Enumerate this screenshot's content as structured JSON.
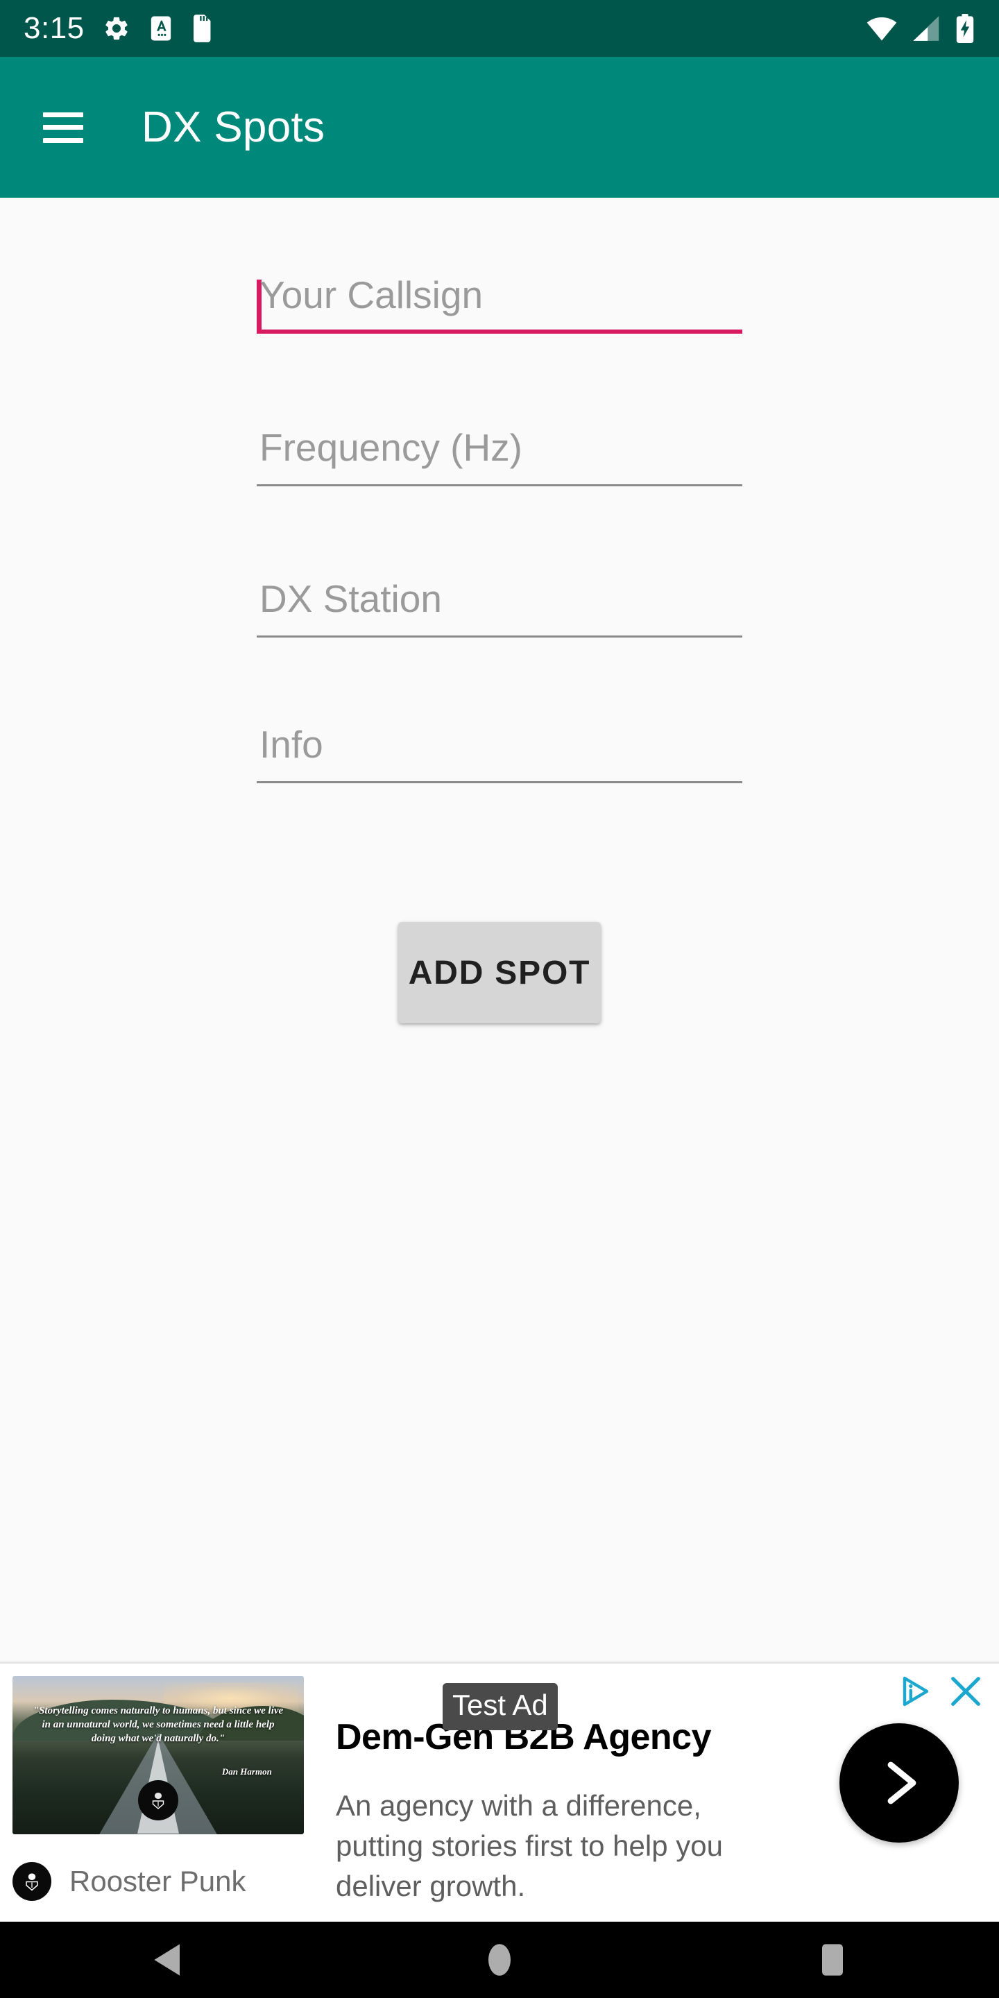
{
  "status_bar": {
    "clock": "3:15",
    "left_icons": [
      {
        "name": "settings-gear-icon"
      },
      {
        "name": "auto-rotate-a-icon"
      },
      {
        "name": "sd-card-icon"
      }
    ],
    "right_icons": [
      {
        "name": "wifi-icon"
      },
      {
        "name": "cellular-signal-icon"
      },
      {
        "name": "battery-charging-icon"
      }
    ],
    "background_color": "#00564B"
  },
  "app_bar": {
    "menu_icon": "hamburger-menu-icon",
    "title": "DX Spots",
    "background_color": "#00897B",
    "text_color": "#FFFFFF"
  },
  "form": {
    "fields": [
      {
        "name": "callsign",
        "placeholder": "Your Callsign",
        "value": "",
        "focused": true
      },
      {
        "name": "frequency",
        "placeholder": "Frequency (Hz)",
        "value": "",
        "focused": false
      },
      {
        "name": "dx_station",
        "placeholder": "DX Station",
        "value": "",
        "focused": false
      },
      {
        "name": "info",
        "placeholder": "Info",
        "value": "",
        "focused": false
      }
    ],
    "submit_label": "ADD SPOT",
    "accent_color": "#D81B60",
    "underline_color": "#8A8A8A",
    "placeholder_color": "#9A9A9A"
  },
  "ad": {
    "badge": "Test Ad",
    "headline": "Dem-Gen B2B Agency",
    "body": "An agency with a difference, putting stories first to help you deliver growth.",
    "advertiser": "Rooster Punk",
    "media_quote": "\"Storytelling comes naturally to humans, but since we live in an unnatural world, we sometimes need a little help doing what we'd naturally do.\"",
    "media_quote_attribution": "Dan Harmon",
    "cta_icon": "chevron-right-icon",
    "adchoices_icon": "adchoices-icon",
    "close_icon": "close-x-icon",
    "accent_color": "#1BA7CE",
    "badge_color": "#4A4A4A"
  },
  "nav_bar": {
    "buttons": [
      {
        "name": "back-triangle-icon"
      },
      {
        "name": "home-circle-icon"
      },
      {
        "name": "recents-square-icon"
      }
    ],
    "background_color": "#000000",
    "icon_color": "#ADADAD"
  }
}
